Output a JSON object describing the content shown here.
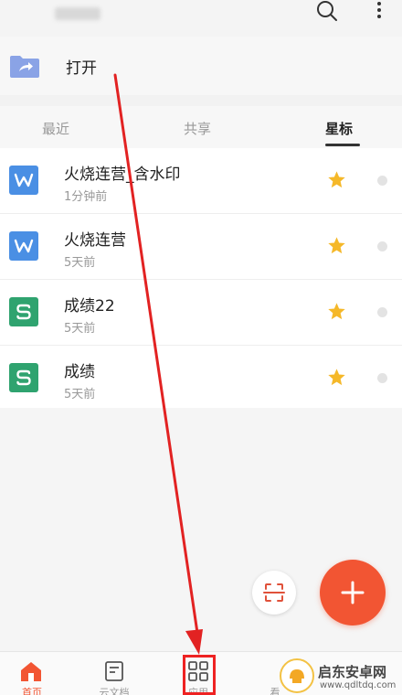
{
  "open_row": {
    "label": "打开"
  },
  "tabs": [
    {
      "label": "最近"
    },
    {
      "label": "共享"
    },
    {
      "label": "星标",
      "active": true
    }
  ],
  "files": [
    {
      "name": "火烧连营_含水印",
      "time": "1分钟前",
      "type": "W",
      "type_color": "#4a8fe4",
      "starred": true
    },
    {
      "name": "火烧连营",
      "time": "5天前",
      "type": "W",
      "type_color": "#4a8fe4",
      "starred": true
    },
    {
      "name": "成绩22",
      "time": "5天前",
      "type": "S",
      "type_color": "#2fa36f",
      "starred": true
    },
    {
      "name": "成绩",
      "time": "5天前",
      "type": "S",
      "type_color": "#2fa36f",
      "starred": true
    }
  ],
  "bottom_nav": [
    {
      "label": "首页",
      "icon": "home-icon",
      "active": true
    },
    {
      "label": "云文档",
      "icon": "cloud-doc-icon"
    },
    {
      "label": "应用",
      "icon": "apps-grid-icon"
    },
    {
      "label": "看",
      "icon": "partial-icon"
    }
  ],
  "watermark": {
    "title": "启东安卓网",
    "url": "www.qdltdq.com"
  },
  "colors": {
    "accent": "#f25533",
    "star": "#f5b829",
    "word_blue": "#4a8fe4",
    "sheet_green": "#2fa36f",
    "annotation_red": "#e22222"
  }
}
